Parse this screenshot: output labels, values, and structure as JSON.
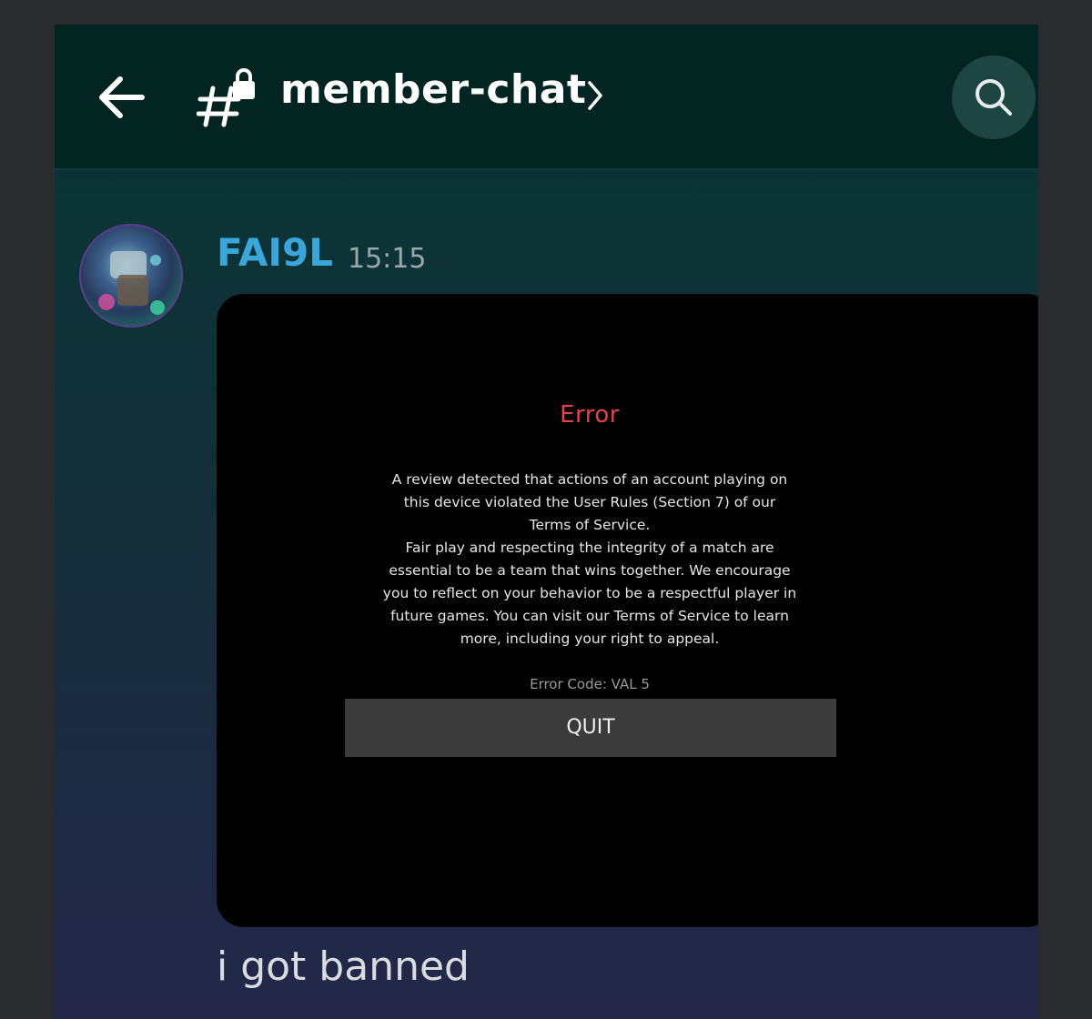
{
  "header": {
    "channel_name": "member-chat",
    "icons": {
      "back": "arrow-left-icon",
      "channel": "locked-hash-icon",
      "chevron": "chevron-right-icon",
      "search": "search-icon"
    }
  },
  "message": {
    "author": "FAI9L",
    "timestamp": "15:15",
    "author_color": "#3aa6d9",
    "attachment": {
      "title": "Error",
      "title_color": "#e0444c",
      "body": "A review detected that actions of an account playing on\nthis device violated the User Rules (Section 7) of our\nTerms of Service.\nFair play and respecting the integrity of a match are\nessential to be a team that wins together.  We encourage\nyou to reflect on your behavior to be a respectful player in\nfuture games. You can visit our Terms of Service to learn\nmore, including your right to appeal.",
      "error_code": "Error Code: VAL 5",
      "button_label": "QUIT"
    },
    "text": "i got banned"
  }
}
